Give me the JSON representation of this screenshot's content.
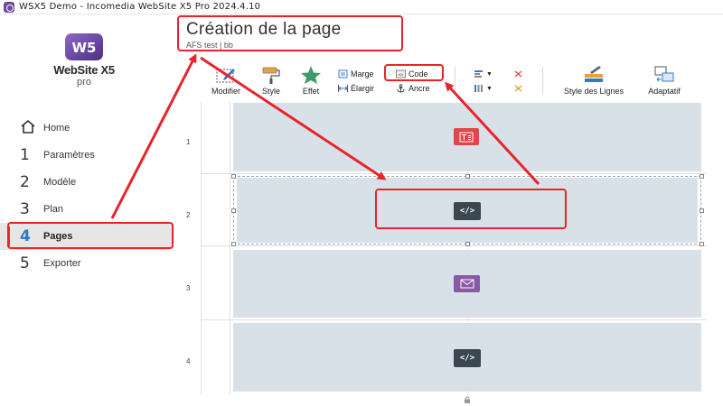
{
  "window": {
    "title": "WSX5 Demo - Incomedia WebSite X5 Pro 2024.4.10",
    "accent_color": "#2e7bc4",
    "annotation_color": "#e8242a"
  },
  "logo": {
    "badge_text": "W5",
    "brand": "WebSite X5",
    "sub": "pro"
  },
  "sidebar": {
    "items": [
      {
        "num": "",
        "icon": "home-icon",
        "label": "Home"
      },
      {
        "num": "1",
        "label": "Paramètres"
      },
      {
        "num": "2",
        "label": "Modèle"
      },
      {
        "num": "3",
        "label": "Plan"
      },
      {
        "num": "4",
        "label": "Pages",
        "active": true
      },
      {
        "num": "5",
        "label": "Exporter"
      }
    ]
  },
  "header": {
    "title": "Création de la page",
    "breadcrumb": "AFS test | bb"
  },
  "toolbar": {
    "modifier": "Modifier",
    "style": "Style",
    "effet": "Effet",
    "marge": "Marge",
    "elargir": "Élargir",
    "code": "Code",
    "ancre": "Ancre",
    "style_lignes": "Style des Lignes",
    "adaptatif": "Adaptatif"
  },
  "canvas": {
    "rows": [
      {
        "number": "1",
        "object": "text-object-icon",
        "color": "#e0474c"
      },
      {
        "number": "2",
        "object": "code-object-icon",
        "color": "#3a4650",
        "selected": true
      },
      {
        "number": "3",
        "object": "email-object-icon",
        "color": "#8a5aa5"
      },
      {
        "number": "4",
        "object": "code-object-icon",
        "color": "#3a4650"
      }
    ],
    "code_glyph": "</>"
  }
}
